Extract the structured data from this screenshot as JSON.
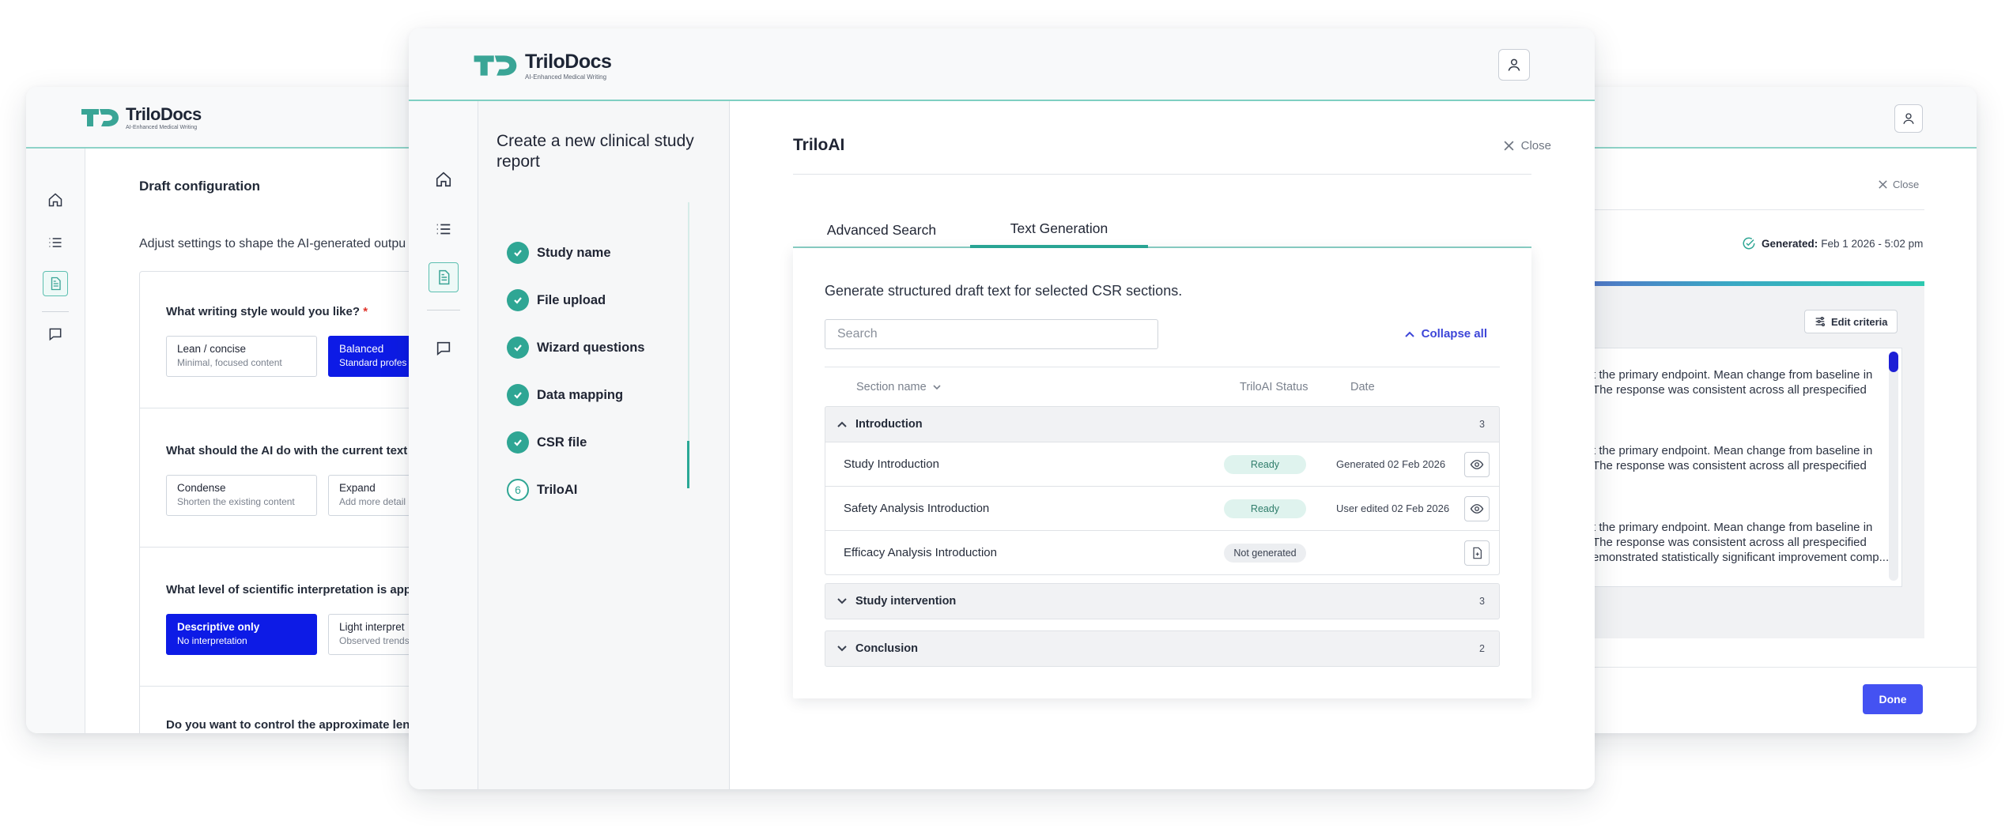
{
  "brand": {
    "name": "TriloDocs",
    "tagline": "AI-Enhanced Medical Writing",
    "logo_mark": "TD",
    "accent": "#3aa596",
    "primary_button": "#4452f2",
    "selected_option": "#0d1be6"
  },
  "nav_icons": [
    "home-icon",
    "list-icon",
    "document-icon",
    "chat-icon"
  ],
  "draft_config": {
    "title": "Draft configuration",
    "subtitle": "Adjust settings to shape the AI-generated outpu",
    "q1": {
      "label": "What writing style would you like?",
      "required_mark": "*",
      "options": [
        {
          "title": "Lean / concise",
          "sub": "Minimal, focused content"
        },
        {
          "title": "Balanced",
          "sub": "Standard profes"
        }
      ]
    },
    "q2": {
      "label": "What should the AI do with the current text",
      "options": [
        {
          "title": "Condense",
          "sub": "Shorten the existing content"
        },
        {
          "title": "Expand",
          "sub": "Add more detail"
        }
      ]
    },
    "q3": {
      "label": "What level of scientific interpretation is app",
      "options": [
        {
          "title": "Descriptive only",
          "sub": "No interpretation"
        },
        {
          "title": "Light interpret",
          "sub": "Observed trends"
        }
      ]
    },
    "q4": {
      "label": "Do you want to control the approximate len"
    }
  },
  "generated_panel": {
    "close_label": "Close",
    "generated_label": "Generated:",
    "generated_value": "Feb 1 2026 - 5:02 pm",
    "edit_criteria": "Edit criteria",
    "paragraphs": [
      {
        "l1": "t the primary endpoint. Mean change from baseline in",
        "l2": " The response was consistent across all prespecified",
        "l3": ""
      },
      {
        "l1": "t the primary endpoint. Mean change from baseline in",
        "l2": " The response was consistent across all prespecified",
        "l3": ""
      },
      {
        "l1": "t the primary endpoint. Mean change from baseline in",
        "l2": " The response was consistent across all prespecified",
        "l3": "emonstrated statistically significant improvement comp..."
      }
    ],
    "done_label": "Done"
  },
  "wizard": {
    "title": "Create a new clinical study report",
    "steps": [
      {
        "label": "Study name"
      },
      {
        "label": "File upload"
      },
      {
        "label": "Wizard questions"
      },
      {
        "label": "Data mapping"
      },
      {
        "label": "CSR file"
      },
      {
        "label": "TriloAI",
        "number": "6"
      }
    ]
  },
  "triloai": {
    "title": "TriloAI",
    "close_label": "Close",
    "tabs": [
      {
        "label": "Advanced Search"
      },
      {
        "label": "Text Generation"
      }
    ],
    "description": "Generate structured draft text for selected CSR sections.",
    "search_placeholder": "Search",
    "collapse_all": "Collapse all",
    "columns": {
      "section": "Section name",
      "status": "TriloAI Status",
      "date": "Date"
    },
    "groups": [
      {
        "name": "Introduction",
        "count": "3",
        "rows": [
          {
            "name": "Study Introduction",
            "status": "Ready",
            "date": "Generated 02 Feb 2026",
            "action": "eye-icon"
          },
          {
            "name": "Safety Analysis Introduction",
            "status": "Ready",
            "date": "User edited 02 Feb 2026",
            "action": "eye-icon"
          },
          {
            "name": "Efficacy Analysis Introduction",
            "status": "Not generated",
            "date": "",
            "action": "file-plus-icon"
          }
        ]
      },
      {
        "name": "Study intervention",
        "count": "3"
      },
      {
        "name": "Conclusion",
        "count": "2"
      }
    ]
  }
}
